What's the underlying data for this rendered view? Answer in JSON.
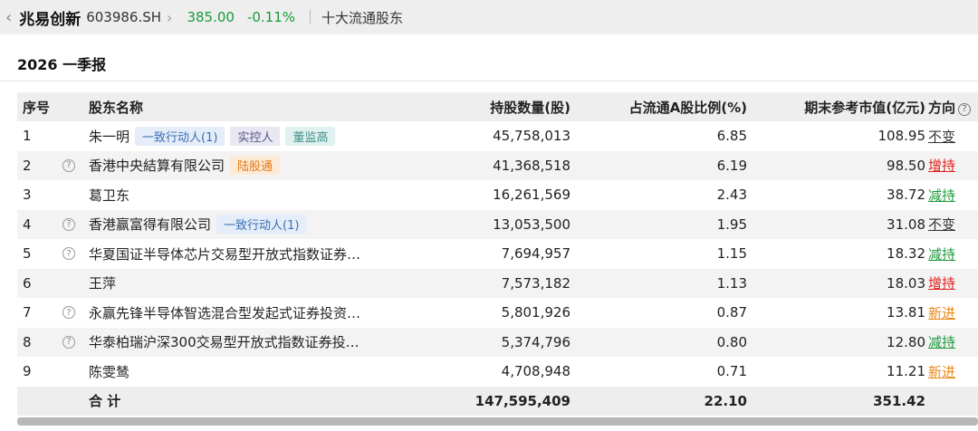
{
  "header": {
    "back_icon": "chevron-left-icon",
    "stock_name": "兆易创新",
    "stock_code": "603986.SH",
    "price": "385.00",
    "change_pct": "-0.11%",
    "section": "十大流通股东"
  },
  "colors": {
    "up": "#e0201c",
    "down": "#1a9a3a",
    "new": "#e88a1a"
  },
  "period": "2026 一季报",
  "table": {
    "columns": [
      "序号",
      "股东名称",
      "持股数量(股)",
      "占流通A股比例(%)",
      "期末参考市值(亿元)",
      "方向"
    ],
    "rows": [
      {
        "idx": "1",
        "help": false,
        "name": "朱一明",
        "tags": [
          {
            "text": "一致行动人(1)",
            "style": "blue"
          },
          {
            "text": "实控人",
            "style": "purple"
          },
          {
            "text": "董监高",
            "style": "teal"
          }
        ],
        "shares": "45,758,013",
        "ratio": "6.85",
        "value": "108.95",
        "dir": "不变",
        "dir_type": "same"
      },
      {
        "idx": "2",
        "help": true,
        "name": "香港中央結算有限公司",
        "tags": [
          {
            "text": "陆股通",
            "style": "orange"
          }
        ],
        "shares": "41,368,518",
        "ratio": "6.19",
        "value": "98.50",
        "dir": "增持",
        "dir_type": "inc"
      },
      {
        "idx": "3",
        "help": false,
        "name": "葛卫东",
        "tags": [],
        "shares": "16,261,569",
        "ratio": "2.43",
        "value": "38.72",
        "dir": "减持",
        "dir_type": "dec"
      },
      {
        "idx": "4",
        "help": true,
        "name": "香港赢富得有限公司",
        "tags": [
          {
            "text": "一致行动人(1)",
            "style": "blue"
          }
        ],
        "shares": "13,053,500",
        "ratio": "1.95",
        "value": "31.08",
        "dir": "不变",
        "dir_type": "same"
      },
      {
        "idx": "5",
        "help": true,
        "name": "华夏国证半导体芯片交易型开放式指数证券…",
        "tags": [],
        "shares": "7,694,957",
        "ratio": "1.15",
        "value": "18.32",
        "dir": "减持",
        "dir_type": "dec"
      },
      {
        "idx": "6",
        "help": false,
        "name": "王萍",
        "tags": [],
        "shares": "7,573,182",
        "ratio": "1.13",
        "value": "18.03",
        "dir": "增持",
        "dir_type": "inc"
      },
      {
        "idx": "7",
        "help": true,
        "name": "永赢先锋半导体智选混合型发起式证券投资…",
        "tags": [],
        "shares": "5,801,926",
        "ratio": "0.87",
        "value": "13.81",
        "dir": "新进",
        "dir_type": "new"
      },
      {
        "idx": "8",
        "help": true,
        "name": "华泰柏瑞沪深300交易型开放式指数证券投…",
        "tags": [],
        "shares": "5,374,796",
        "ratio": "0.80",
        "value": "12.80",
        "dir": "减持",
        "dir_type": "dec"
      },
      {
        "idx": "9",
        "help": false,
        "name": "陈雯鸶",
        "tags": [],
        "shares": "4,708,948",
        "ratio": "0.71",
        "value": "11.21",
        "dir": "新进",
        "dir_type": "new"
      }
    ],
    "total": {
      "label": "合 计",
      "shares": "147,595,409",
      "ratio": "22.10",
      "value": "351.42"
    }
  }
}
